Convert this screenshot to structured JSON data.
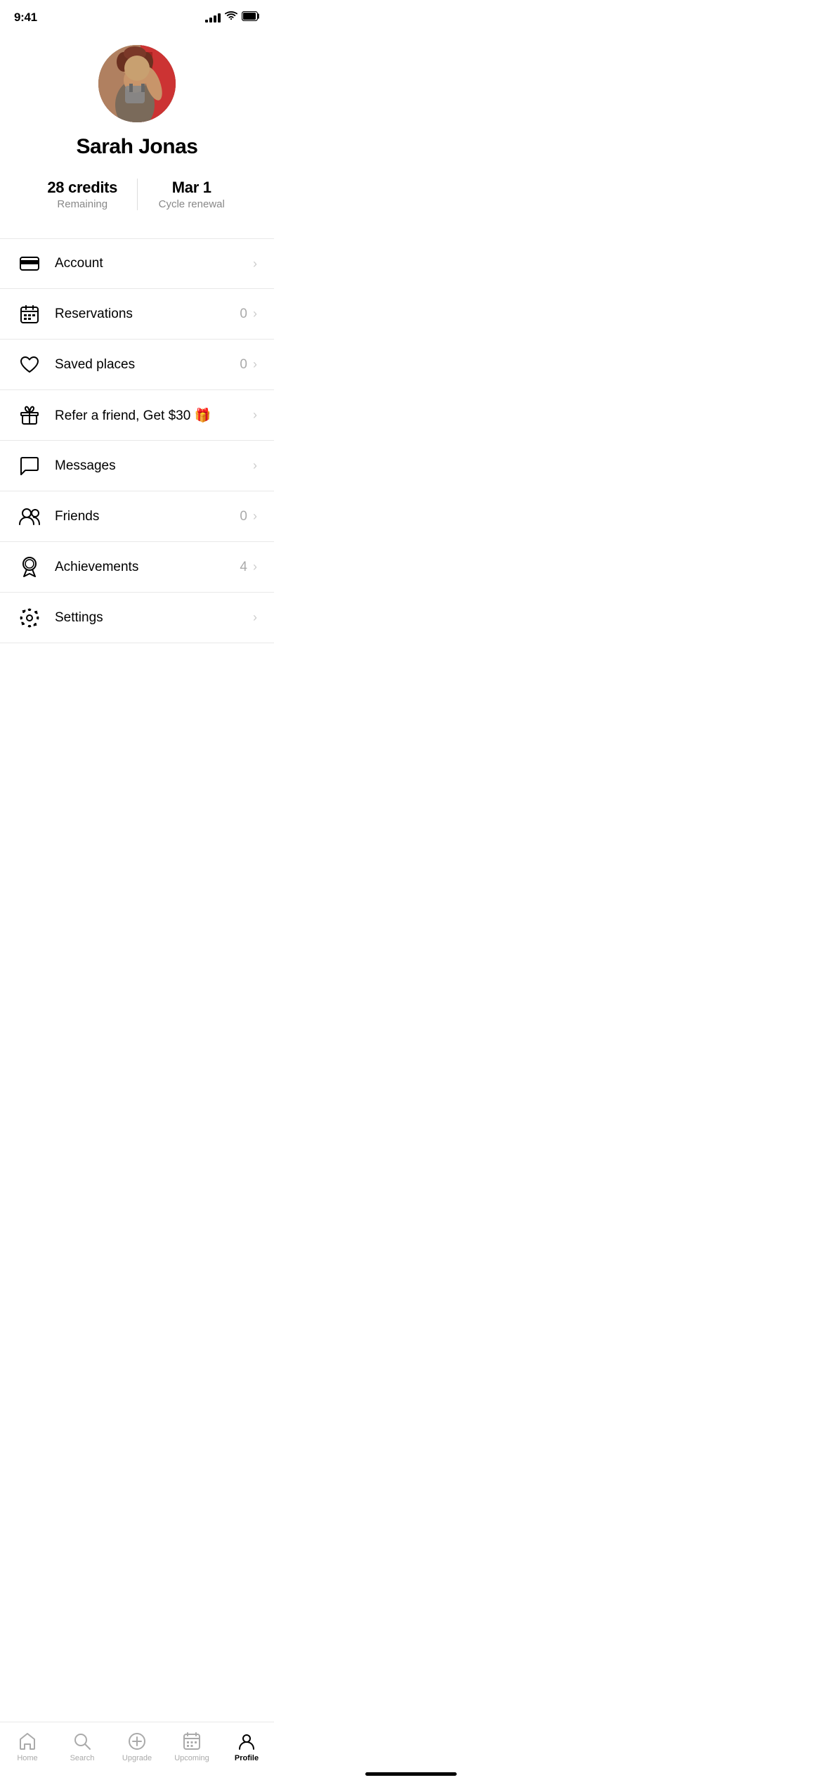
{
  "statusBar": {
    "time": "9:41"
  },
  "profile": {
    "name": "Sarah Jonas",
    "credits": "28 credits",
    "creditsLabel": "Remaining",
    "renewalDate": "Mar 1",
    "renewalLabel": "Cycle renewal"
  },
  "menuItems": [
    {
      "id": "account",
      "icon": "credit-card",
      "label": "Account",
      "count": null,
      "emoji": null
    },
    {
      "id": "reservations",
      "icon": "calendar",
      "label": "Reservations",
      "count": "0",
      "emoji": null
    },
    {
      "id": "saved-places",
      "icon": "heart",
      "label": "Saved places",
      "count": "0",
      "emoji": null
    },
    {
      "id": "refer",
      "icon": "gift",
      "label": "Refer a friend, Get $30 🎁",
      "count": null,
      "emoji": null
    },
    {
      "id": "messages",
      "icon": "message",
      "label": "Messages",
      "count": null,
      "emoji": null
    },
    {
      "id": "friends",
      "icon": "friends",
      "label": "Friends",
      "count": "0",
      "emoji": null
    },
    {
      "id": "achievements",
      "icon": "achievement",
      "label": "Achievements",
      "count": "4",
      "emoji": null
    },
    {
      "id": "settings",
      "icon": "settings",
      "label": "Settings",
      "count": null,
      "emoji": null
    }
  ],
  "tabBar": {
    "items": [
      {
        "id": "home",
        "label": "Home",
        "active": false
      },
      {
        "id": "search",
        "label": "Search",
        "active": false
      },
      {
        "id": "upgrade",
        "label": "Upgrade",
        "active": false
      },
      {
        "id": "upcoming",
        "label": "Upcoming",
        "active": false
      },
      {
        "id": "profile",
        "label": "Profile",
        "active": true
      }
    ]
  }
}
